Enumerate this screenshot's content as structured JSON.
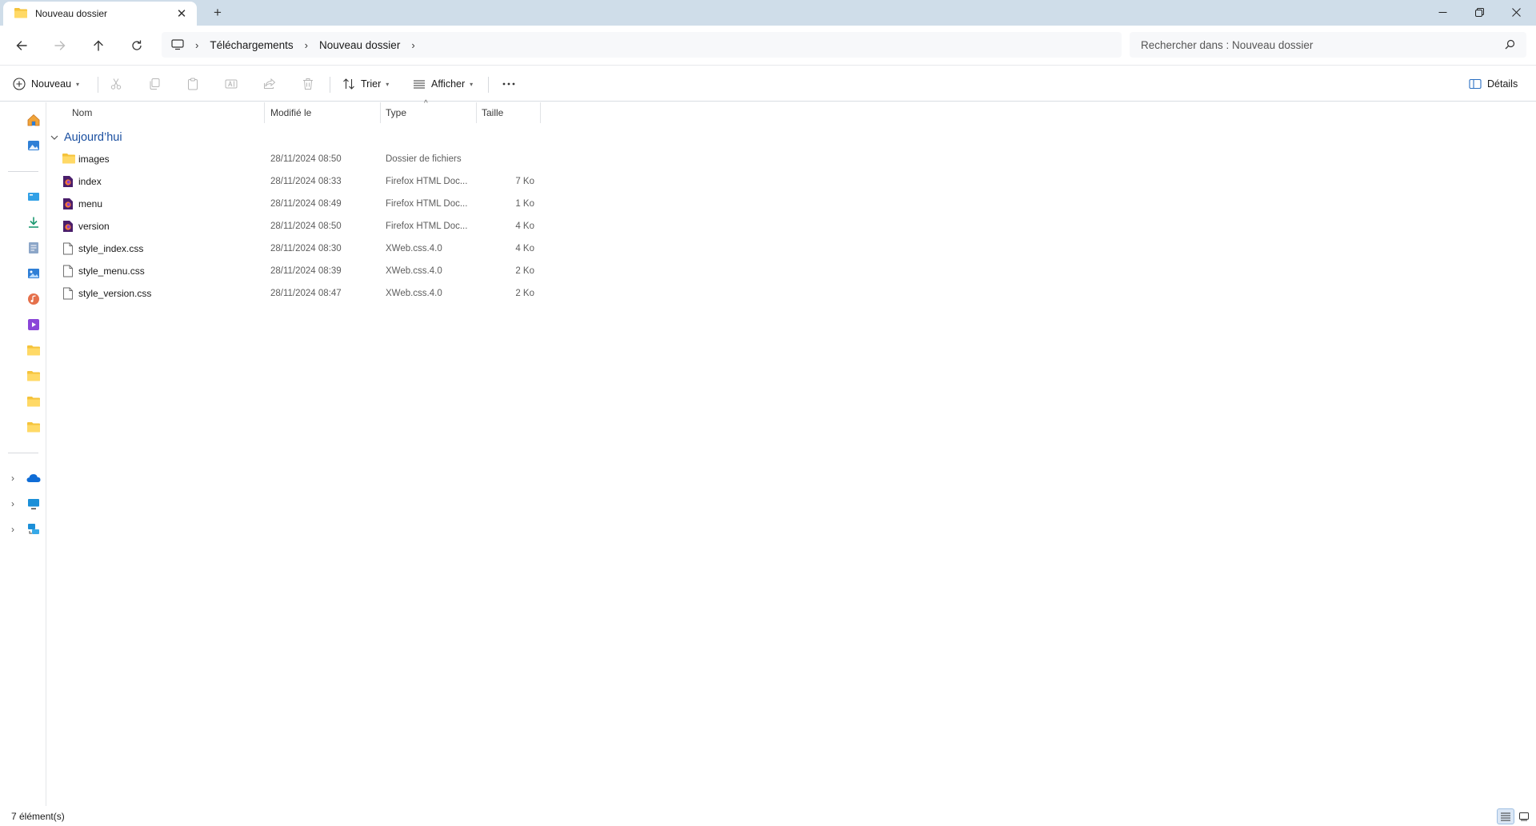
{
  "window": {
    "tab_title": "Nouveau dossier",
    "new_tab_icon": "plus-icon",
    "controls": [
      "minimize-icon",
      "restore-icon",
      "close-icon"
    ]
  },
  "address": {
    "breadcrumbs": [
      "Téléchargements",
      "Nouveau dossier"
    ],
    "search_placeholder": "Rechercher dans : Nouveau dossier"
  },
  "toolbar": {
    "new_label": "Nouveau",
    "sort_label": "Trier",
    "view_label": "Afficher",
    "details_label": "Détails"
  },
  "columns": {
    "name": "Nom",
    "modified": "Modifié le",
    "type": "Type",
    "size": "Taille"
  },
  "group": {
    "label": "Aujourd’hui"
  },
  "files": [
    {
      "name": "images",
      "modified": "28/11/2024 08:50",
      "type": "Dossier de fichiers",
      "size": "",
      "icon": "folder-icon"
    },
    {
      "name": "index",
      "modified": "28/11/2024 08:33",
      "type": "Firefox HTML Doc...",
      "size": "7 Ko",
      "icon": "firefox-html-icon"
    },
    {
      "name": "menu",
      "modified": "28/11/2024 08:49",
      "type": "Firefox HTML Doc...",
      "size": "1 Ko",
      "icon": "firefox-html-icon"
    },
    {
      "name": "version",
      "modified": "28/11/2024 08:50",
      "type": "Firefox HTML Doc...",
      "size": "4 Ko",
      "icon": "firefox-html-icon"
    },
    {
      "name": "style_index.css",
      "modified": "28/11/2024 08:30",
      "type": "XWeb.css.4.0",
      "size": "4 Ko",
      "icon": "file-icon"
    },
    {
      "name": "style_menu.css",
      "modified": "28/11/2024 08:39",
      "type": "XWeb.css.4.0",
      "size": "2 Ko",
      "icon": "file-icon"
    },
    {
      "name": "style_version.css",
      "modified": "28/11/2024 08:47",
      "type": "XWeb.css.4.0",
      "size": "2 Ko",
      "icon": "file-icon"
    }
  ],
  "status": {
    "count_text": "7 élément(s)"
  },
  "colors": {
    "titlebar": "#cfdde9",
    "accent": "#1a4fa0",
    "folder": "#f5c33b"
  }
}
